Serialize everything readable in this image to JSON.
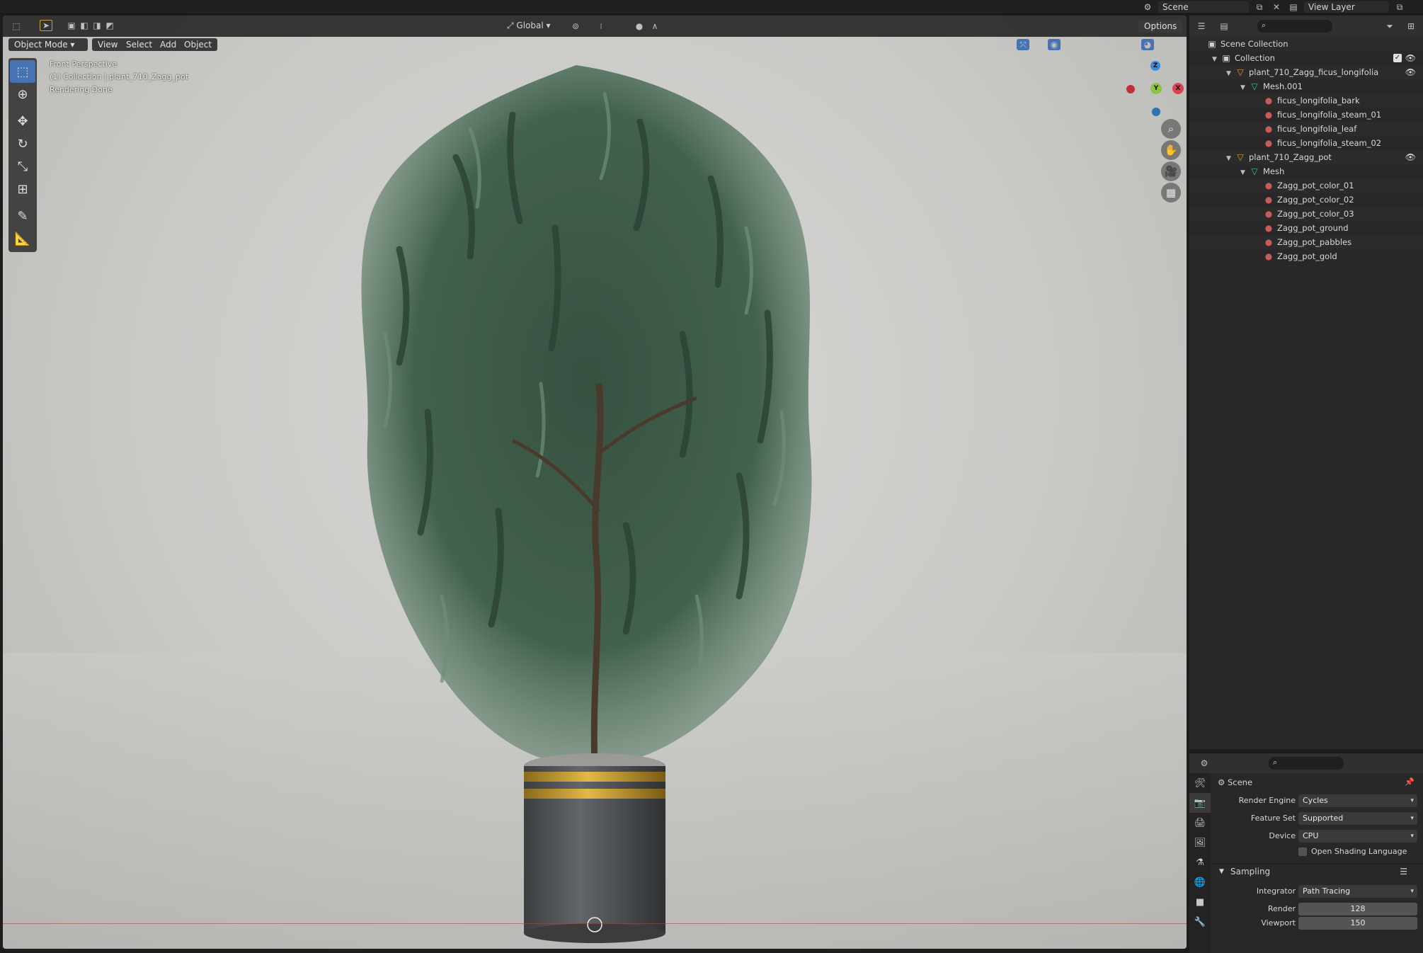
{
  "topbar": {
    "scene_label": "Scene",
    "view_layer_label": "View Layer"
  },
  "viewport": {
    "header": {
      "mode": "Object Mode",
      "menus": [
        "View",
        "Select",
        "Add",
        "Object"
      ],
      "transform_orientation": "Global",
      "options": "Options"
    },
    "overlay": {
      "view_name": "Front Perspective",
      "collection_info": "(1) Collection | plant_710_Zagg_pot",
      "status": "Rendering Done"
    },
    "gizmo": {
      "z": "Z",
      "y": "Y",
      "x": "X"
    }
  },
  "outliner": {
    "rows": [
      {
        "label": "Scene Collection",
        "indent": 0,
        "icon": "collection-icon",
        "triangle": ""
      },
      {
        "label": "Collection",
        "indent": 1,
        "icon": "collection-icon",
        "triangle": "▼"
      },
      {
        "label": "plant_710_Zagg_ficus_longifolia",
        "indent": 2,
        "icon": "object-icon",
        "triangle": "▼"
      },
      {
        "label": "Mesh.001",
        "indent": 3,
        "icon": "mesh-icon",
        "triangle": "▼"
      },
      {
        "label": "ficus_longifolia_bark",
        "indent": 4,
        "icon": "material-icon",
        "triangle": ""
      },
      {
        "label": "ficus_longifolia_steam_01",
        "indent": 4,
        "icon": "material-icon",
        "triangle": ""
      },
      {
        "label": "ficus_longifolia_leaf",
        "indent": 4,
        "icon": "material-icon",
        "triangle": ""
      },
      {
        "label": "ficus_longifolia_steam_02",
        "indent": 4,
        "icon": "material-icon",
        "triangle": ""
      },
      {
        "label": "plant_710_Zagg_pot",
        "indent": 2,
        "icon": "object-icon",
        "triangle": "▼"
      },
      {
        "label": "Mesh",
        "indent": 3,
        "icon": "mesh-icon",
        "triangle": "▼"
      },
      {
        "label": "Zagg_pot_color_01",
        "indent": 4,
        "icon": "material-icon",
        "triangle": ""
      },
      {
        "label": "Zagg_pot_color_02",
        "indent": 4,
        "icon": "material-icon",
        "triangle": ""
      },
      {
        "label": "Zagg_pot_color_03",
        "indent": 4,
        "icon": "material-icon",
        "triangle": ""
      },
      {
        "label": "Zagg_pot_ground",
        "indent": 4,
        "icon": "material-icon",
        "triangle": ""
      },
      {
        "label": "Zagg_pot_pabbles",
        "indent": 4,
        "icon": "material-icon",
        "triangle": ""
      },
      {
        "label": "Zagg_pot_gold",
        "indent": 4,
        "icon": "material-icon",
        "triangle": ""
      }
    ]
  },
  "properties": {
    "context": "Scene",
    "render_engine": {
      "label": "Render Engine",
      "value": "Cycles"
    },
    "feature_set": {
      "label": "Feature Set",
      "value": "Supported"
    },
    "device": {
      "label": "Device",
      "value": "CPU"
    },
    "osl": {
      "label": "Open Shading Language"
    },
    "sampling": {
      "title": "Sampling",
      "integrator": {
        "label": "Integrator",
        "value": "Path Tracing"
      },
      "render": {
        "label": "Render",
        "value": "128"
      },
      "viewport": {
        "label": "Viewport",
        "value": "150"
      }
    }
  },
  "colors": {
    "accent": "#4772b3",
    "gizmo_x": "#e04050",
    "gizmo_y": "#8cc63f",
    "gizmo_z": "#3b8ae0",
    "material": "#c95a5a",
    "object": "#e39a3a",
    "mesh": "#3fc29c"
  }
}
